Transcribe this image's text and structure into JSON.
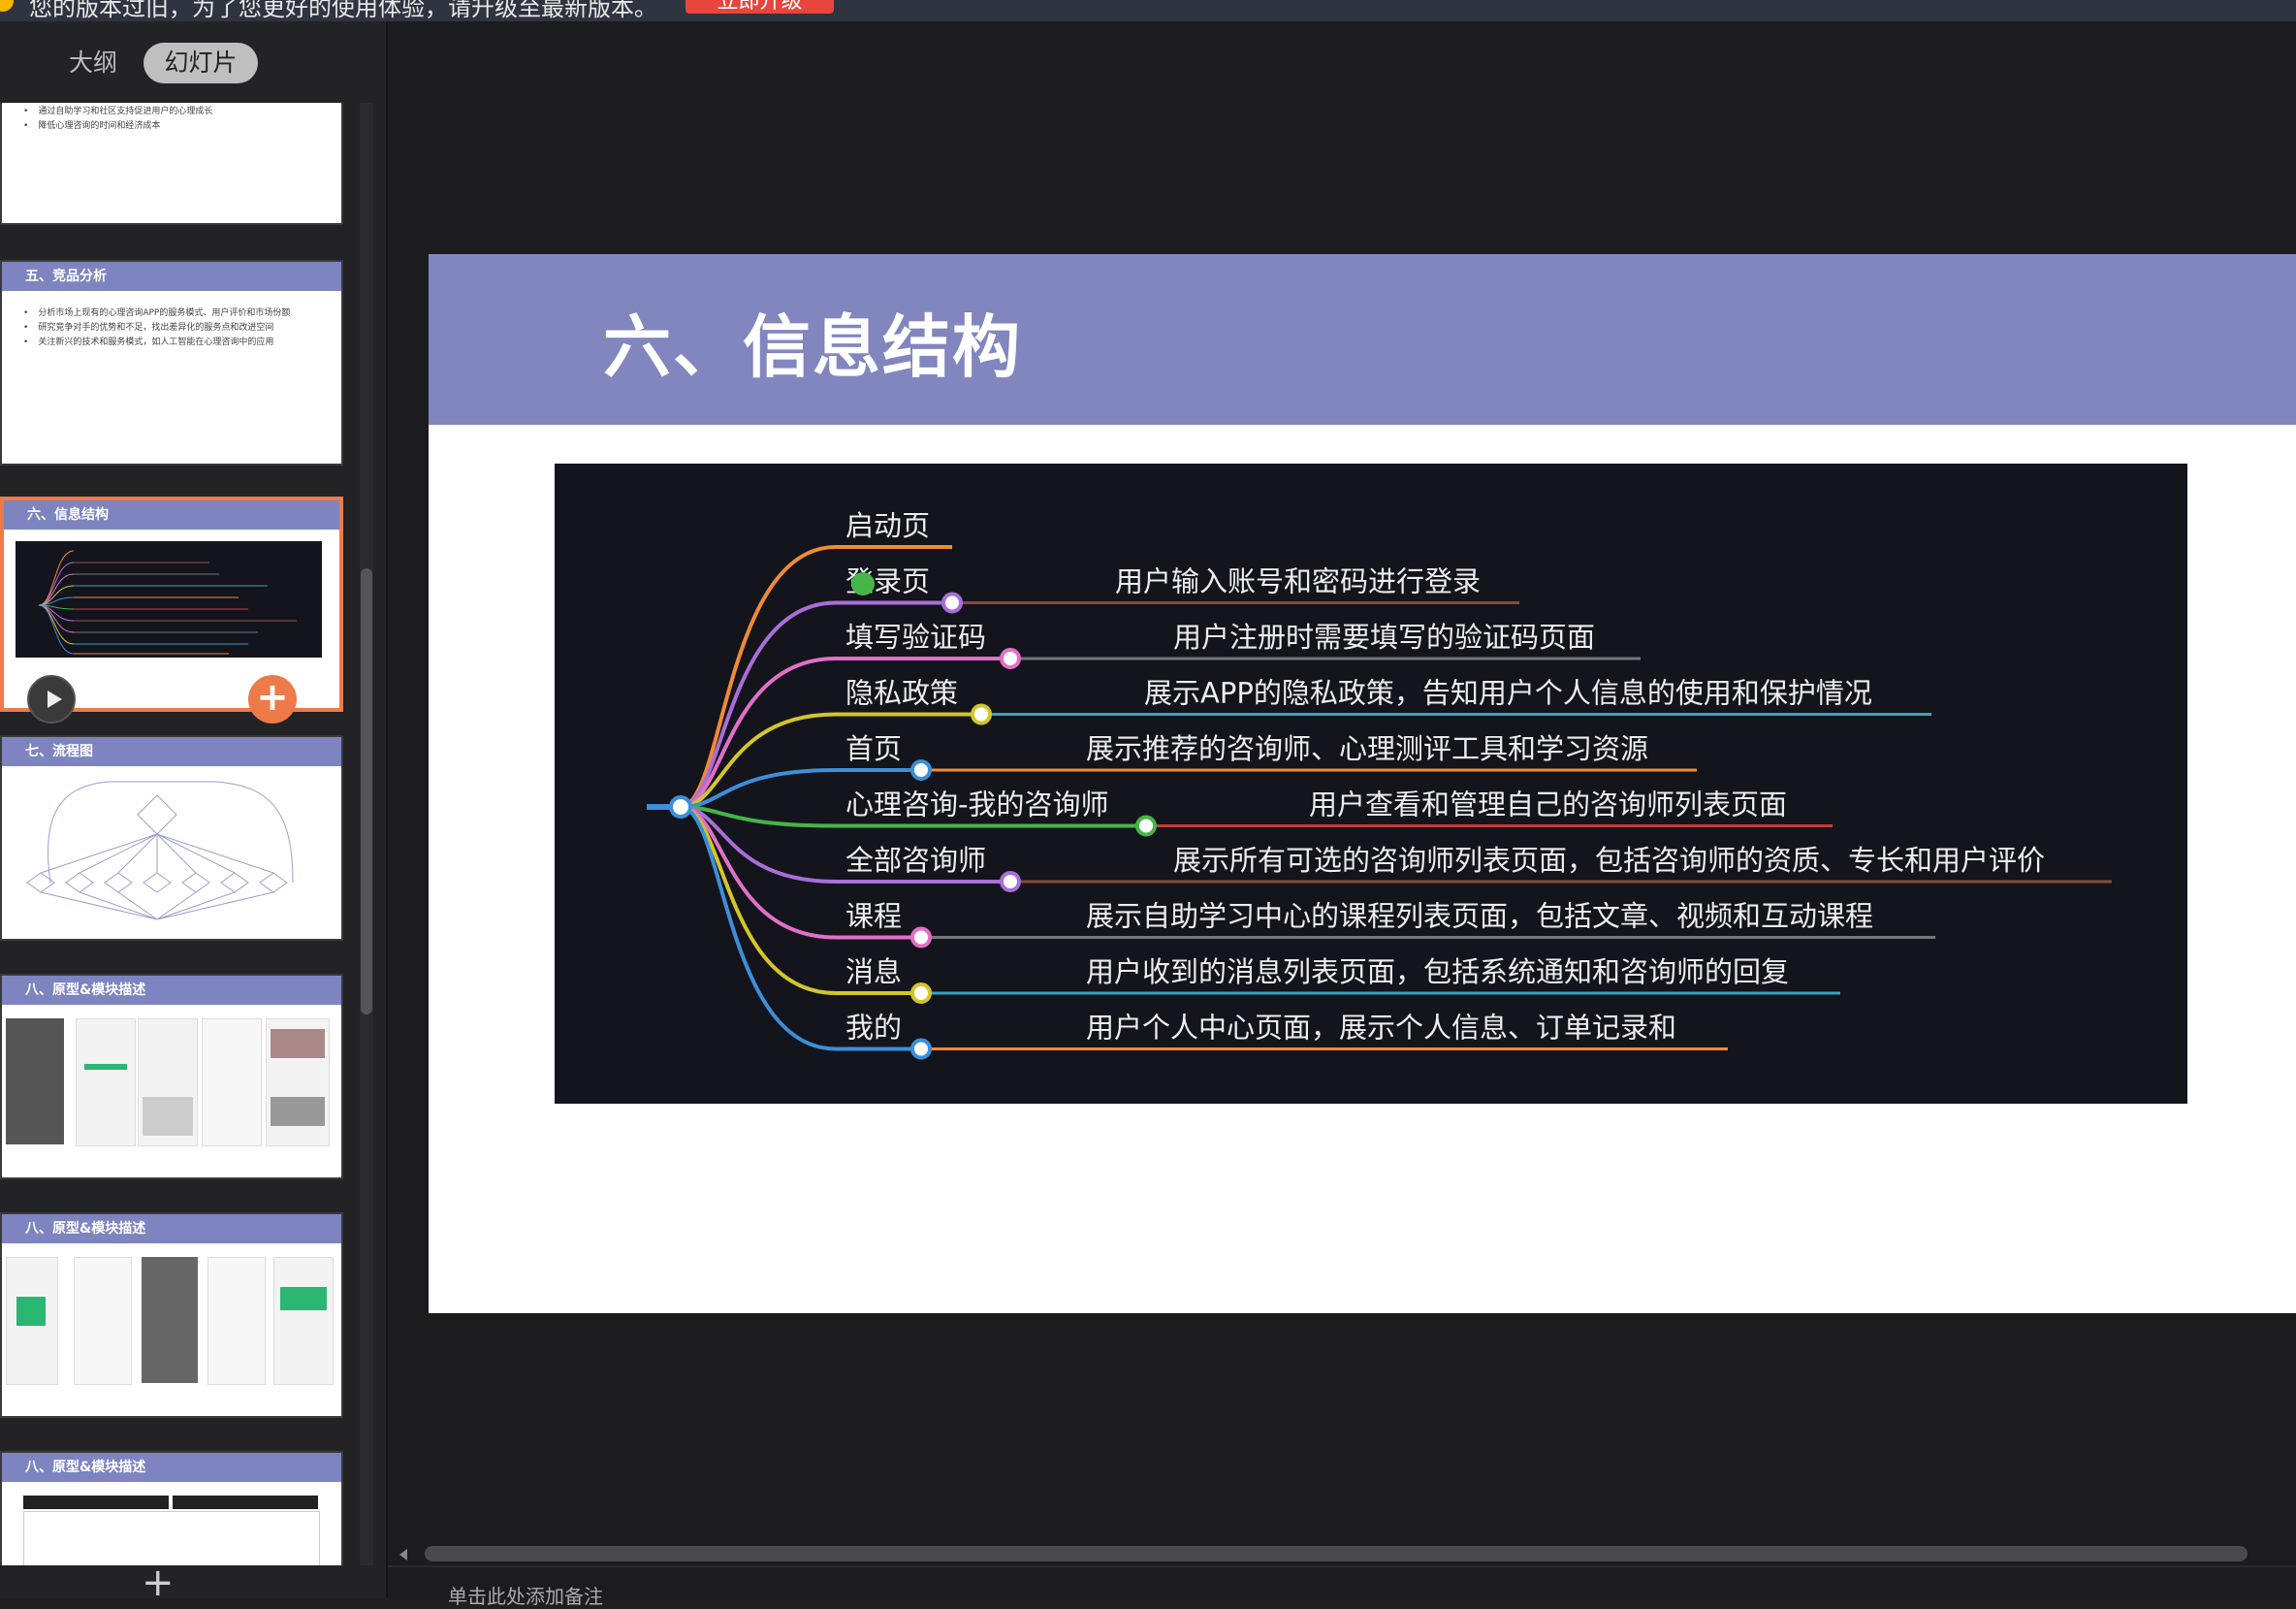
{
  "top_banner": {
    "message": "您的版本过旧，为了您更好的使用体验，请升级至最新版本。",
    "upgrade_button": "立即升级"
  },
  "sidebar": {
    "tabs": [
      "大纲",
      "幻灯片"
    ],
    "active_tab": "幻灯片",
    "slides": [
      {
        "title": "",
        "bullets": [
          "通过自助学习和社区支持促进用户的心理成长",
          "降低心理咨询的时间和经济成本"
        ]
      },
      {
        "title": "五、竞品分析",
        "bullets": [
          "分析市场上现有的心理咨询APP的服务模式、用户评价和市场份额",
          "研究竞争对手的优势和不足，找出差异化的服务点和改进空间",
          "关注新兴的技术和服务模式，如人工智能在心理咨询中的应用"
        ]
      },
      {
        "title": "六、信息结构",
        "selected": true
      },
      {
        "title": "七、流程图"
      },
      {
        "title": "八、原型&模块描述"
      },
      {
        "title": "八、原型&模块描述"
      },
      {
        "title": "八、原型&模块描述"
      }
    ]
  },
  "slide": {
    "title": "六、信息结构",
    "mindmap": {
      "nodes": [
        {
          "label": "启动页",
          "desc": "",
          "color": "#f08a35"
        },
        {
          "label": "登录页",
          "desc": "用户输入账号和密码进行登录",
          "color": "#a86fd8"
        },
        {
          "label": "填写验证码",
          "desc": "用户注册时需要填写的验证码页面",
          "color": "#e070c8"
        },
        {
          "label": "隐私政策",
          "desc": "展示APP的隐私政策，告知用户个人信息的使用和保护情况",
          "color": "#d4c52a"
        },
        {
          "label": "首页",
          "desc": "展示推荐的咨询师、心理测评工具和学习资源",
          "color": "#3d8fd6"
        },
        {
          "label": "心理咨询-我的咨询师",
          "desc": "用户查看和管理自己的咨询师列表页面",
          "color": "#45b548"
        },
        {
          "label": "全部咨询师",
          "desc": "展示所有可选的咨询师列表页面，包括咨询师的资质、专长和用户评价",
          "color": "#a86fd8"
        },
        {
          "label": "课程",
          "desc": "展示自助学习中心的课程列表页面，包括文章、视频和互动课程",
          "color": "#e070c8"
        },
        {
          "label": "消息",
          "desc": "用户收到的消息列表页面，包括系统通知和咨询师的回复",
          "color": "#d4c52a"
        },
        {
          "label": "我的",
          "desc": "用户个人中心页面，展示个人信息、订单记录和",
          "color": "#3d8fd6"
        }
      ]
    }
  },
  "notes_placeholder": "单击此处添加备注"
}
